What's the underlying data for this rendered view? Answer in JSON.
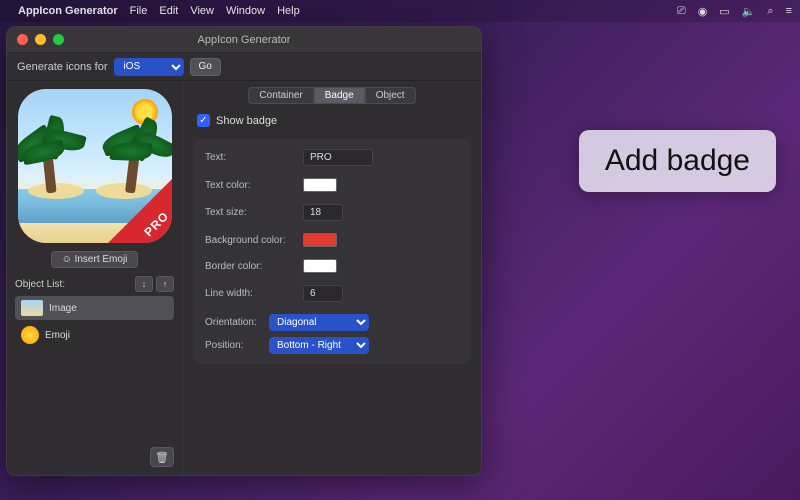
{
  "menubar": {
    "app": "AppIcon Generator",
    "items": [
      "File",
      "Edit",
      "View",
      "Window",
      "Help"
    ]
  },
  "window": {
    "title": "AppIcon Generator"
  },
  "toolbar": {
    "label": "Generate icons for",
    "platform": "iOS",
    "go": "Go"
  },
  "preview": {
    "badge_text": "PRO"
  },
  "left": {
    "insert": "Insert Emoji",
    "list_label": "Object List:",
    "items": [
      {
        "label": "Image"
      },
      {
        "label": "Emoji"
      }
    ]
  },
  "tabs": {
    "container": "Container",
    "badge": "Badge",
    "object": "Object"
  },
  "badge_panel": {
    "show": "Show badge",
    "text_label": "Text:",
    "text_value": "PRO",
    "textcolor_label": "Text color:",
    "textsize_label": "Text size:",
    "textsize_value": "18",
    "bgcolor_label": "Background color:",
    "bordercolor_label": "Border color:",
    "linewidth_label": "Line width:",
    "linewidth_value": "6",
    "orientation_label": "Orientation:",
    "orientation_value": "Diagonal",
    "position_label": "Position:",
    "position_value": "Bottom - Right"
  },
  "callout": "Add badge",
  "colors": {
    "text": "#ffffff",
    "bg": "#e53a2f",
    "border": "#ffffff"
  }
}
